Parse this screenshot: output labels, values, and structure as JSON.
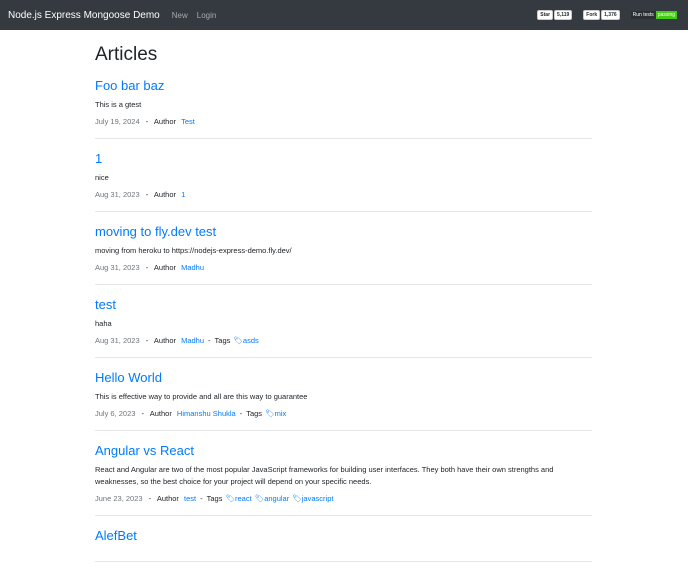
{
  "nav": {
    "brand": "Node.js Express Mongoose Demo",
    "links": [
      "New",
      "Login"
    ],
    "star_label": "Star",
    "star_count": "5,119",
    "fork_label": "Fork",
    "fork_count": "1,376",
    "ci_label": "Run tests",
    "ci_status": "passing"
  },
  "page": {
    "title": "Articles",
    "author_label": "Author",
    "tags_label": "Tags",
    "sep": "-"
  },
  "articles": [
    {
      "title": "Foo bar baz",
      "desc": "This is a gtest",
      "date": "July 19, 2024",
      "author": "Test",
      "tags": []
    },
    {
      "title": "1",
      "desc": "nice",
      "date": "Aug 31, 2023",
      "author": "1",
      "tags": []
    },
    {
      "title": "moving to fly.dev test",
      "desc": "moving from heroku to https://nodejs-express-demo.fly.dev/",
      "date": "Aug 31, 2023",
      "author": "Madhu",
      "tags": []
    },
    {
      "title": "test",
      "desc": "haha",
      "date": "Aug 31, 2023",
      "author": "Madhu",
      "tags": [
        "asds"
      ]
    },
    {
      "title": "Hello World",
      "desc": "This is effective way to provide and all are this way to guarantee",
      "date": "July 6, 2023",
      "author": "Himanshu Shukla",
      "tags": [
        "mix"
      ]
    },
    {
      "title": "Angular vs React",
      "desc": "React and Angular are two of the most popular JavaScript frameworks for building user interfaces. They both have their own strengths and weaknesses, so the best choice for your project will depend on your specific needs.",
      "date": "June 23, 2023",
      "author": "test",
      "tags": [
        "react",
        "angular",
        "javascript"
      ]
    },
    {
      "title": "AlefBet",
      "desc": "",
      "date": "",
      "author": "",
      "tags": []
    }
  ]
}
